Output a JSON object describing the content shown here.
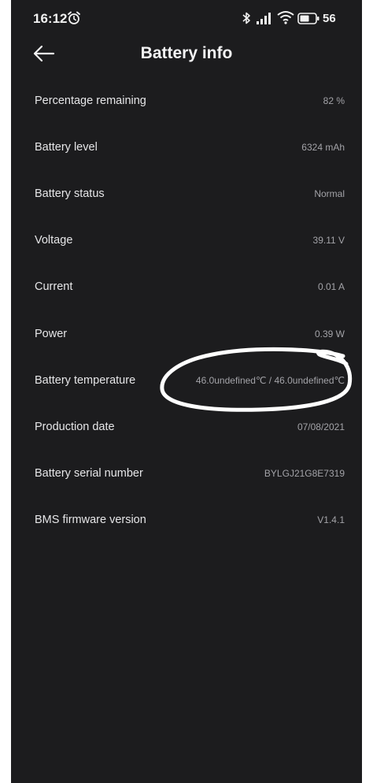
{
  "status_bar": {
    "time": "16:12",
    "battery_percent": "56",
    "icons": [
      "alarm-icon",
      "bluetooth-icon",
      "signal-icon",
      "wifi-icon",
      "battery-icon"
    ]
  },
  "header": {
    "title": "Battery info",
    "back_icon": "back-arrow-icon"
  },
  "rows": [
    {
      "label": "Percentage remaining",
      "value": "82 %"
    },
    {
      "label": "Battery level",
      "value": "6324 mAh"
    },
    {
      "label": "Battery status",
      "value": "Normal"
    },
    {
      "label": "Voltage",
      "value": "39.11 V"
    },
    {
      "label": "Current",
      "value": "0.01 A"
    },
    {
      "label": "Power",
      "value": "0.39 W"
    },
    {
      "label": "Battery temperature",
      "value": "46.0undefined℃ / 46.0undefined℃"
    },
    {
      "label": "Production date",
      "value": "07/08/2021"
    },
    {
      "label": "Battery serial number",
      "value": "BYLGJ21G8E7319"
    },
    {
      "label": "BMS firmware version",
      "value": "V1.4.1"
    }
  ],
  "colors": {
    "background": "#1c1c1e",
    "label": "#e6e6e8",
    "value": "#a3a3a8",
    "annotation": "#ffffff"
  }
}
